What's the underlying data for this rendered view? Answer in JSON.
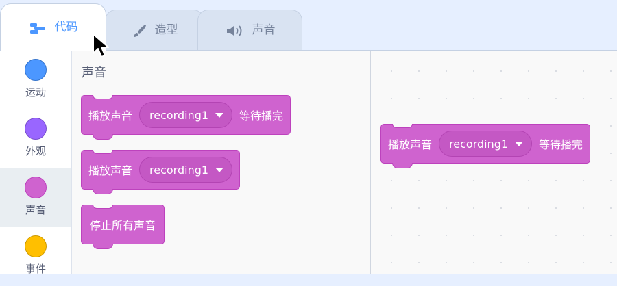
{
  "tabs": [
    {
      "label": "代码",
      "icon": "code-icon",
      "active": true
    },
    {
      "label": "造型",
      "icon": "paintbrush-icon",
      "active": false
    },
    {
      "label": "声音",
      "icon": "speaker-icon",
      "active": false
    }
  ],
  "categories": [
    {
      "label": "运动",
      "color": "#4c97ff",
      "selected": false
    },
    {
      "label": "外观",
      "color": "#9966ff",
      "selected": false
    },
    {
      "label": "声音",
      "color": "#cf63cf",
      "selected": true
    },
    {
      "label": "事件",
      "color": "#ffbf00",
      "selected": false
    }
  ],
  "palette": {
    "title": "声音",
    "blocks": [
      {
        "text": "播放声音",
        "dropdown": "recording1",
        "suffix": "等待播完"
      },
      {
        "text": "播放声音",
        "dropdown": "recording1"
      },
      {
        "text": "停止所有声音"
      }
    ]
  },
  "workspace": {
    "blocks": [
      {
        "text": "播放声音",
        "dropdown": "recording1",
        "suffix": "等待播完"
      }
    ]
  },
  "colors": {
    "sound_block": "#cf63cf",
    "sound_block_border": "#bd42bd",
    "dropdown_fill": "#c458c4",
    "active_tab_text": "#4c97ff"
  }
}
